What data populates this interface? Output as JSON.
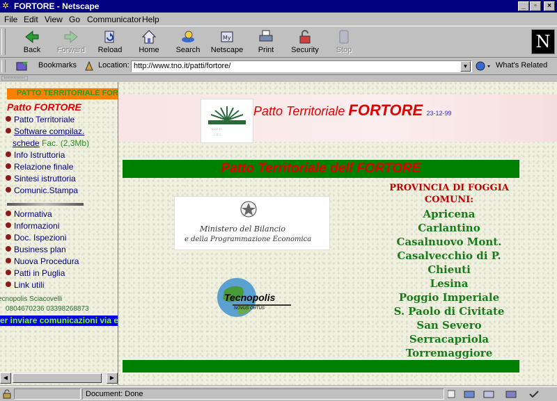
{
  "window": {
    "title": "FORTORE - Netscape"
  },
  "menu": [
    "File",
    "Edit",
    "View",
    "Go",
    "Communicator",
    "Help"
  ],
  "toolbar": [
    {
      "label": "Back",
      "icon": "back-arrow-icon",
      "enabled": true
    },
    {
      "label": "Forward",
      "icon": "forward-arrow-icon",
      "enabled": false
    },
    {
      "label": "Reload",
      "icon": "reload-icon",
      "enabled": true
    },
    {
      "label": "Home",
      "icon": "home-icon",
      "enabled": true
    },
    {
      "label": "Search",
      "icon": "search-icon",
      "enabled": true
    },
    {
      "label": "Netscape",
      "icon": "netscape-icon",
      "enabled": true
    },
    {
      "label": "Print",
      "icon": "print-icon",
      "enabled": true
    },
    {
      "label": "Security",
      "icon": "security-lock-icon",
      "enabled": true
    },
    {
      "label": "Stop",
      "icon": "stop-icon",
      "enabled": false
    }
  ],
  "location": {
    "bookmarks_label": "Bookmarks",
    "location_label": "Location:",
    "url": "http://www.tno.it/patti/fortore/",
    "related_label": "What's Related"
  },
  "left": {
    "banner": "PATTO TERRITORIALE FORTORE",
    "heading": "Patto FORTORE",
    "links1": [
      "Patto Territoriale",
      "Software compilaz.",
      "Info Istruttoria",
      "Relazione finale",
      "Sintesi istruttoria",
      "Comunic.Stampa"
    ],
    "software_line2_link": "schede",
    "software_line2_text": "Fac. (2,3Mb)",
    "links2": [
      "Normativa",
      "Informazioni",
      "Doc. Ispezioni",
      "Business plan",
      "Nuova Procedura",
      "Patti in Puglia",
      "Link utili"
    ],
    "tecnopolis": "Tecnopolis Sciacovelli",
    "phones": "0804670236 03398268873",
    "ticker": "Per inviare comunicazioni via e-mail"
  },
  "header": {
    "title_prefix": "Patto Territoriale ",
    "title_emph": "FORTORE",
    "date": "23-12-99"
  },
  "main": {
    "green_title": "Patto Territoriale dell FORTORE",
    "provincia": "PROVINCIA DI FOGGIA",
    "comuni_label": "COMUNI:",
    "comuni": [
      "Apricena",
      "Carlantino",
      "Casalnuovo Mont.",
      "Casalvecchio di P.",
      "Chieuti",
      "Lesina",
      "Poggio Imperiale",
      "S. Paolo di Civitate",
      "San Severo",
      "Serracapriola",
      "Torremaggiore"
    ],
    "ministero_line1": "Ministero del Bilancio",
    "ministero_line2": "e della Programmazione Economica",
    "tecnopolis_logo": "Tecnopolis",
    "tecnopolis_motto": "NOVUS ORTUS"
  },
  "status": {
    "text": "Document: Done"
  },
  "colors": {
    "green": "#008000",
    "red": "#e00000",
    "navy": "#000080",
    "comuni_green": "#1a7a1a"
  }
}
